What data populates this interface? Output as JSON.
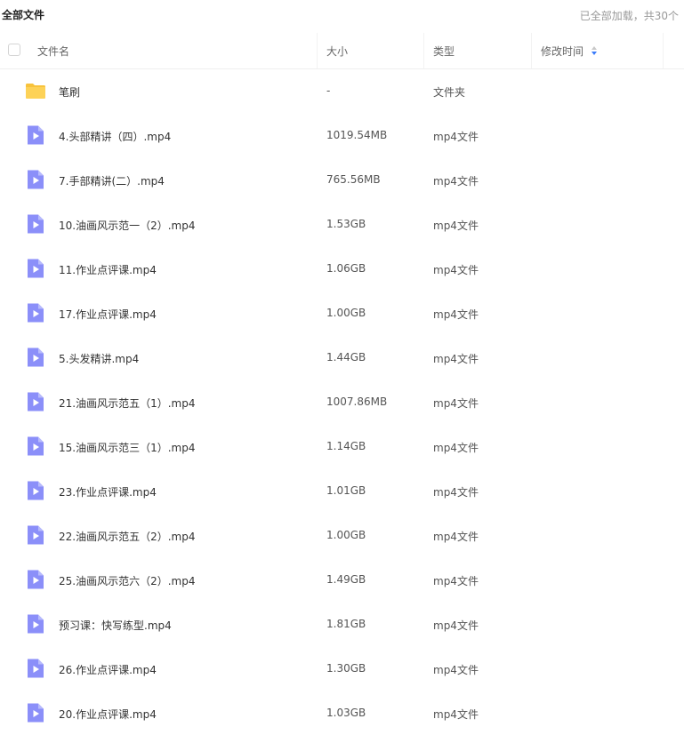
{
  "page": {
    "title": "全部文件",
    "load_status": "已全部加载，共30个"
  },
  "header": {
    "name": "文件名",
    "size": "大小",
    "type": "类型",
    "mtime": "修改时间"
  },
  "colors": {
    "folder": "#f8c33c",
    "video": "#8b8ff9",
    "sort_accent": "#3a7bfa"
  },
  "rows": [
    {
      "icon": "folder-icon",
      "name": "笔刷",
      "size": "-",
      "type": "文件夹"
    },
    {
      "icon": "video-file-icon",
      "name": "4.头部精讲（四）.mp4",
      "size": "1019.54MB",
      "type": "mp4文件"
    },
    {
      "icon": "video-file-icon",
      "name": "7.手部精讲(二）.mp4",
      "size": "765.56MB",
      "type": "mp4文件"
    },
    {
      "icon": "video-file-icon",
      "name": "10.油画风示范一（2）.mp4",
      "size": "1.53GB",
      "type": "mp4文件"
    },
    {
      "icon": "video-file-icon",
      "name": "11.作业点评课.mp4",
      "size": "1.06GB",
      "type": "mp4文件"
    },
    {
      "icon": "video-file-icon",
      "name": "17.作业点评课.mp4",
      "size": "1.00GB",
      "type": "mp4文件"
    },
    {
      "icon": "video-file-icon",
      "name": "5.头发精讲.mp4",
      "size": "1.44GB",
      "type": "mp4文件"
    },
    {
      "icon": "video-file-icon",
      "name": "21.油画风示范五（1）.mp4",
      "size": "1007.86MB",
      "type": "mp4文件"
    },
    {
      "icon": "video-file-icon",
      "name": "15.油画风示范三（1）.mp4",
      "size": "1.14GB",
      "type": "mp4文件"
    },
    {
      "icon": "video-file-icon",
      "name": "23.作业点评课.mp4",
      "size": "1.01GB",
      "type": "mp4文件"
    },
    {
      "icon": "video-file-icon",
      "name": "22.油画风示范五（2）.mp4",
      "size": "1.00GB",
      "type": "mp4文件"
    },
    {
      "icon": "video-file-icon",
      "name": "25.油画风示范六（2）.mp4",
      "size": "1.49GB",
      "type": "mp4文件"
    },
    {
      "icon": "video-file-icon",
      "name": "预习课：快写练型.mp4",
      "size": "1.81GB",
      "type": "mp4文件"
    },
    {
      "icon": "video-file-icon",
      "name": "26.作业点评课.mp4",
      "size": "1.30GB",
      "type": "mp4文件"
    },
    {
      "icon": "video-file-icon",
      "name": "20.作业点评课.mp4",
      "size": "1.03GB",
      "type": "mp4文件"
    }
  ]
}
